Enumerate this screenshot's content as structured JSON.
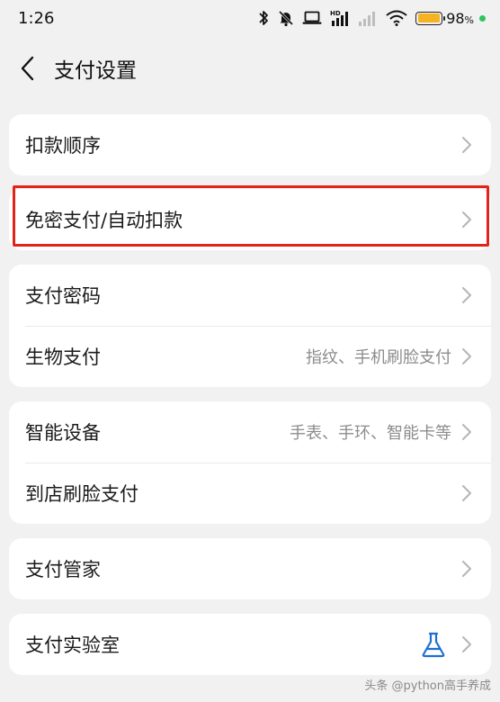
{
  "status_bar": {
    "time": "1:26",
    "battery_percent": "98",
    "battery_unit": "%",
    "battery_color": "#f5b324"
  },
  "header": {
    "title": "支付设置",
    "back_icon": "chevron-left-icon"
  },
  "sections": [
    {
      "rows": [
        {
          "label": "扣款顺序",
          "value": ""
        }
      ]
    },
    {
      "rows": [
        {
          "label": "免密支付/自动扣款",
          "value": ""
        }
      ]
    },
    {
      "rows": [
        {
          "label": "支付密码",
          "value": ""
        },
        {
          "label": "生物支付",
          "value": "指纹、手机刷脸支付"
        }
      ]
    },
    {
      "rows": [
        {
          "label": "智能设备",
          "value": "手表、手环、智能卡等"
        },
        {
          "label": "到店刷脸支付",
          "value": ""
        }
      ]
    },
    {
      "rows": [
        {
          "label": "支付管家",
          "value": ""
        }
      ]
    },
    {
      "rows": [
        {
          "label": "支付实验室",
          "value": "",
          "icon": "flask-icon"
        }
      ]
    }
  ],
  "highlight_color": "#e2231a",
  "accent_color": "#1f6fd1",
  "watermark": "头条 @python高手养成"
}
